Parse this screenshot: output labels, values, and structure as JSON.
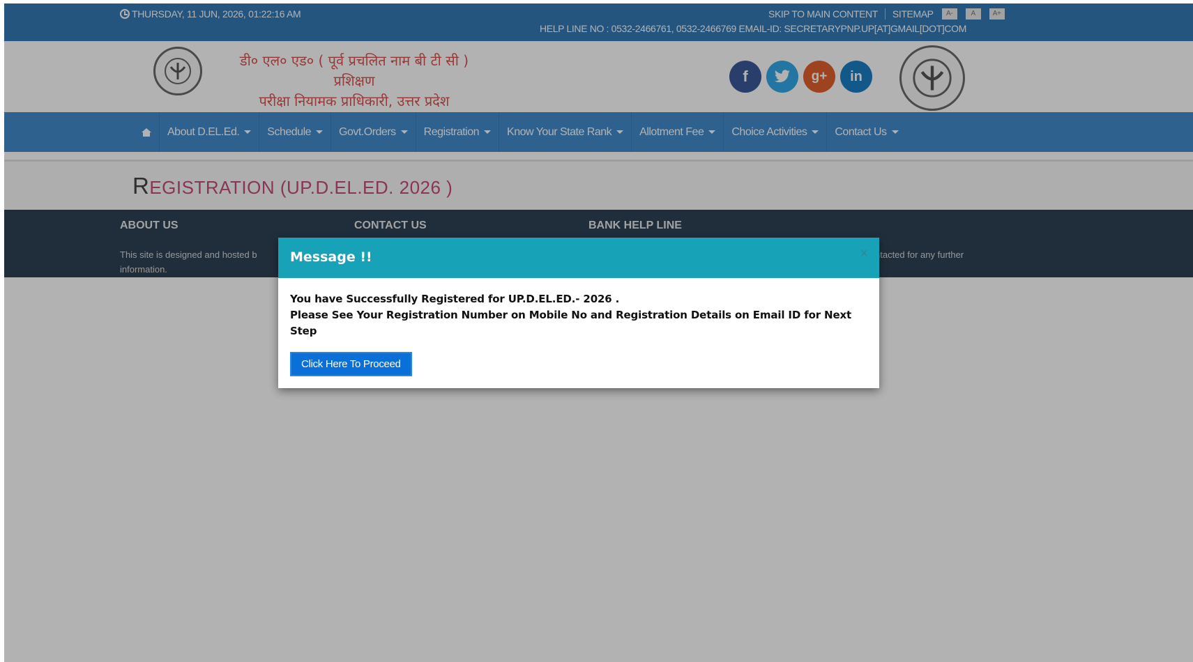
{
  "topbar": {
    "datetime": "THURSDAY, 11 JUN, 2026, 01:22:16 AM",
    "skip_link": "SKIP TO MAIN CONTENT",
    "sitemap": "SITEMAP",
    "font_buttons": [
      "A-",
      "A",
      "A+"
    ],
    "helpline": "HELP LINE NO : 0532-2466761, 0532-2466769 EMAIL-ID: SECRETARYPNP.UP[AT]GMAIL[DOT]COM"
  },
  "header": {
    "hindi_line1": "डी० एल० एड० ( पूर्व प्रचलित नाम बी टी सी ) प्रशिक्षण",
    "hindi_line2": "परीक्षा नियामक प्राधिकारी, उत्तर प्रदेश",
    "social": {
      "facebook": "f",
      "twitter": "t",
      "googleplus": "g+",
      "linkedin": "in"
    }
  },
  "nav": {
    "items": [
      {
        "label": "About D.EL.Ed."
      },
      {
        "label": "Schedule"
      },
      {
        "label": "Govt.Orders"
      },
      {
        "label": "Registration"
      },
      {
        "label": "Know Your State Rank"
      },
      {
        "label": "Allotment Fee"
      },
      {
        "label": "Choice Activities"
      },
      {
        "label": "Contact Us"
      }
    ]
  },
  "page": {
    "title_first": "R",
    "title_rest": "EGISTRATION (UP.D.EL.ED. 2026 )"
  },
  "footer": {
    "about_heading": "ABOUT US",
    "contact_heading": "CONTACT US",
    "bank_heading": "BANK HELP LINE",
    "about_text_1": "This site is designed and hosted b",
    "about_text_2": "information.",
    "right_text": "ntacted for any further"
  },
  "modal": {
    "title": "Message !!",
    "close": "×",
    "line1": "You have Successfully Registered for UP.D.EL.ED.- 2026 .",
    "line2": "Please See Your Registration Number on Mobile No and Registration Details on Email ID for Next Step",
    "button": "Click Here To Proceed"
  }
}
